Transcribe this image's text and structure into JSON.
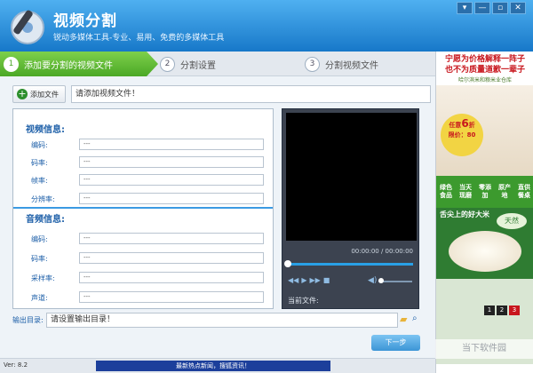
{
  "app": {
    "title": "视频分割",
    "subtitle": "锐动多媒体工具-专业、易用、免费的多媒体工具"
  },
  "window": {
    "controls": [
      "▾",
      "—",
      "▫",
      "✕"
    ]
  },
  "steps": [
    {
      "num": "1",
      "label": "添加要分割的视频文件"
    },
    {
      "num": "2",
      "label": "分割设置"
    },
    {
      "num": "3",
      "label": "分割视频文件"
    }
  ],
  "file": {
    "add_label": "添加文件",
    "placeholder": "请添加视频文件！"
  },
  "video_info": {
    "title": "视频信息:",
    "fields": [
      {
        "label": "编码:",
        "value": "---"
      },
      {
        "label": "码率:",
        "value": "---"
      },
      {
        "label": "帧率:",
        "value": "---"
      },
      {
        "label": "分辨率:",
        "value": "---"
      }
    ]
  },
  "audio_info": {
    "title": "音频信息:",
    "fields": [
      {
        "label": "编码:",
        "value": "---"
      },
      {
        "label": "码率:",
        "value": "---"
      },
      {
        "label": "采样率:",
        "value": "---"
      },
      {
        "label": "声道:",
        "value": "---"
      }
    ]
  },
  "player": {
    "time": "00:00:00 / 00:00:00",
    "current_file_label": "当前文件:",
    "progress": 0.0
  },
  "output": {
    "label": "输出目录:",
    "placeholder": "请设置输出目录！"
  },
  "next_label": "下一步",
  "footer": {
    "version": "Ver: 8.2",
    "news": "最新热点新闻，搜狐资讯！"
  },
  "ad": {
    "top_line1": "宁愿为价格解释一阵子",
    "top_line2": "也不为质量道歉一辈子",
    "top_small": "哈尔滨米和粮米业仓库",
    "promo": [
      "任意",
      "6",
      "折",
      "限价：80"
    ],
    "green_tags": [
      "绿色食品",
      "当天现磨",
      "零添加",
      "原产地",
      "直供餐桌"
    ],
    "tag": "舌尖上的好大米",
    "tianran": "天然",
    "pages": [
      "1",
      "2",
      "3"
    ],
    "logo": "当下软件园"
  }
}
